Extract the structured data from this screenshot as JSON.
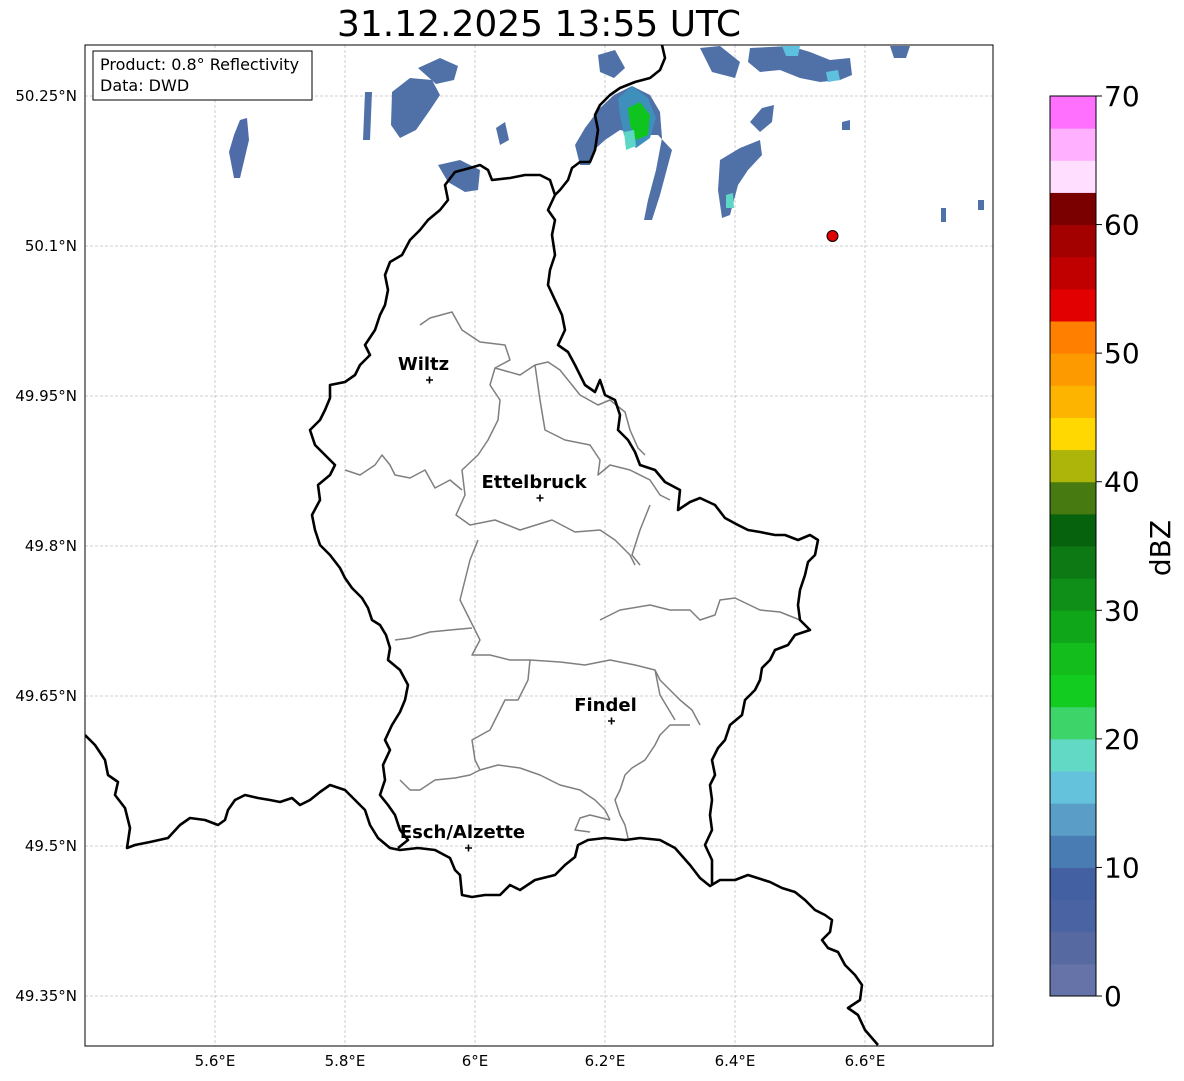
{
  "title": "31.12.2025 13:55 UTC",
  "info_box": {
    "product": "Product: 0.8° Reflectivity",
    "data": "Data: DWD"
  },
  "map": {
    "lat_ticks": [
      "50.25°N",
      "50.1°N",
      "49.95°N",
      "49.8°N",
      "49.65°N",
      "49.5°N",
      "49.35°N"
    ],
    "lon_ticks": [
      "5.6°E",
      "5.8°E",
      "6°E",
      "6.2°E",
      "6.4°E",
      "6.6°E"
    ],
    "cities": [
      {
        "name": "Wiltz",
        "lon": 5.93,
        "lat": 49.966
      },
      {
        "name": "Ettelbruck",
        "lon": 6.1,
        "lat": 49.848
      },
      {
        "name": "Findel",
        "lon": 6.21,
        "lat": 49.625
      },
      {
        "name": "Esch/Alzette",
        "lon": 5.99,
        "lat": 49.498
      }
    ],
    "marker": {
      "lon": 6.55,
      "lat": 50.11,
      "color": "#e00000"
    },
    "colors": {
      "border": "#000000",
      "canton": "#7f7f7f",
      "grid": "#c0c0c0"
    }
  },
  "colorbar": {
    "label": "dBZ",
    "ticks": [
      "0",
      "10",
      "20",
      "30",
      "40",
      "50",
      "60",
      "70"
    ],
    "colors": [
      "#6673a8",
      "#566aa1",
      "#4a63a3",
      "#4361a2",
      "#4a7cb4",
      "#5a9ec8",
      "#65c2dc",
      "#62d9c4",
      "#3dd46a",
      "#12cd1f",
      "#12bd1c",
      "#10a61a",
      "#0f8f17",
      "#0d7914",
      "#07620e",
      "#477b12",
      "#adb40a",
      "#fed800",
      "#fcb400",
      "#fc9a00",
      "#ff7f00",
      "#e20000",
      "#c00000",
      "#a30000",
      "#7a0000",
      "#ffdeff",
      "#ffb0ff",
      "#ff70ff",
      "#ec3cec"
    ]
  }
}
